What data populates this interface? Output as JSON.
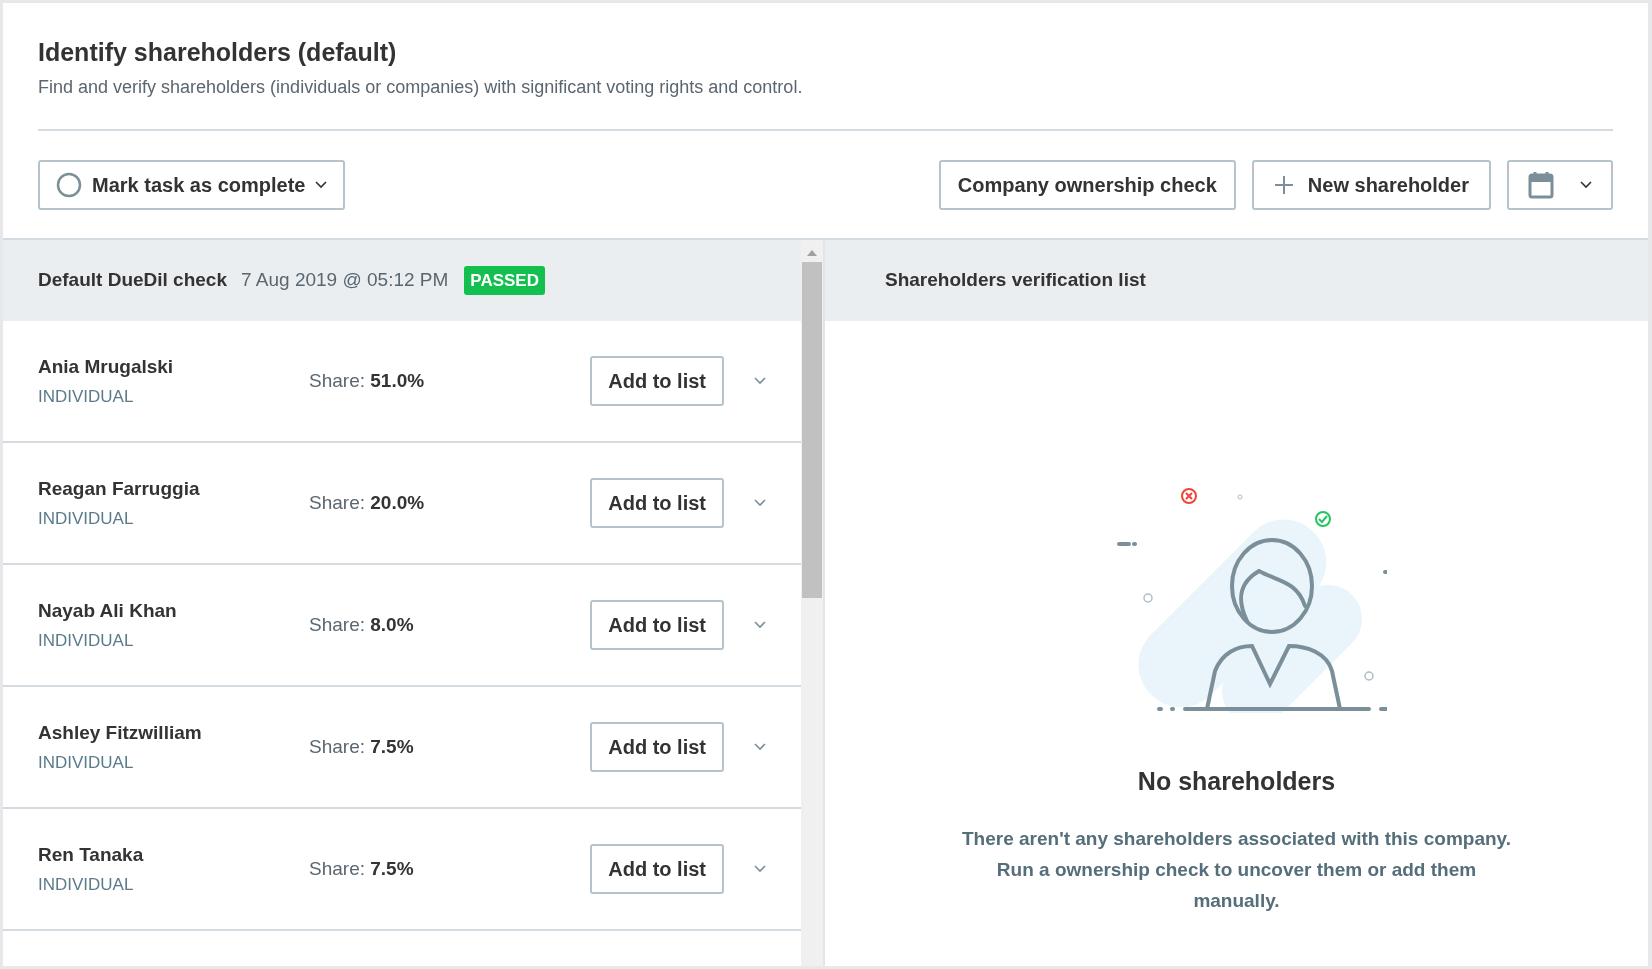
{
  "header": {
    "title": "Identify shareholders (default)",
    "subtitle": "Find and verify shareholders (individuals or companies) with significant voting rights and control."
  },
  "toolbar": {
    "task_button": {
      "label": "Mark task as complete",
      "checked": false
    },
    "buttons": [
      {
        "kind": "text",
        "label": "Company ownership check"
      },
      {
        "kind": "add",
        "label": "New shareholder"
      },
      {
        "kind": "calendar"
      }
    ]
  },
  "check": {
    "name": "Default DueDil check",
    "date": "7 Aug 2019 @ 05:12 PM",
    "status": "PASSED"
  },
  "shareholders": [
    {
      "name": "Ania Mrugalski",
      "type": "INDIVIDUAL",
      "share_label": "Share:",
      "share": "51.0%",
      "action": "Add to list"
    },
    {
      "name": "Reagan Farruggia",
      "type": "INDIVIDUAL",
      "share_label": "Share:",
      "share": "20.0%",
      "action": "Add to list"
    },
    {
      "name": "Nayab Ali Khan",
      "type": "INDIVIDUAL",
      "share_label": "Share:",
      "share": "8.0%",
      "action": "Add to list"
    },
    {
      "name": "Ashley Fitzwilliam",
      "type": "INDIVIDUAL",
      "share_label": "Share:",
      "share": "7.5%",
      "action": "Add to list"
    },
    {
      "name": "Ren Tanaka",
      "type": "INDIVIDUAL",
      "share_label": "Share:",
      "share": "7.5%",
      "action": "Add to list"
    }
  ],
  "verification_list": {
    "title": "Shareholders verification list",
    "empty_title": "No shareholders",
    "empty_text": "There aren't any shareholders associated with this company. Run a ownership check to uncover them or add them manually."
  }
}
